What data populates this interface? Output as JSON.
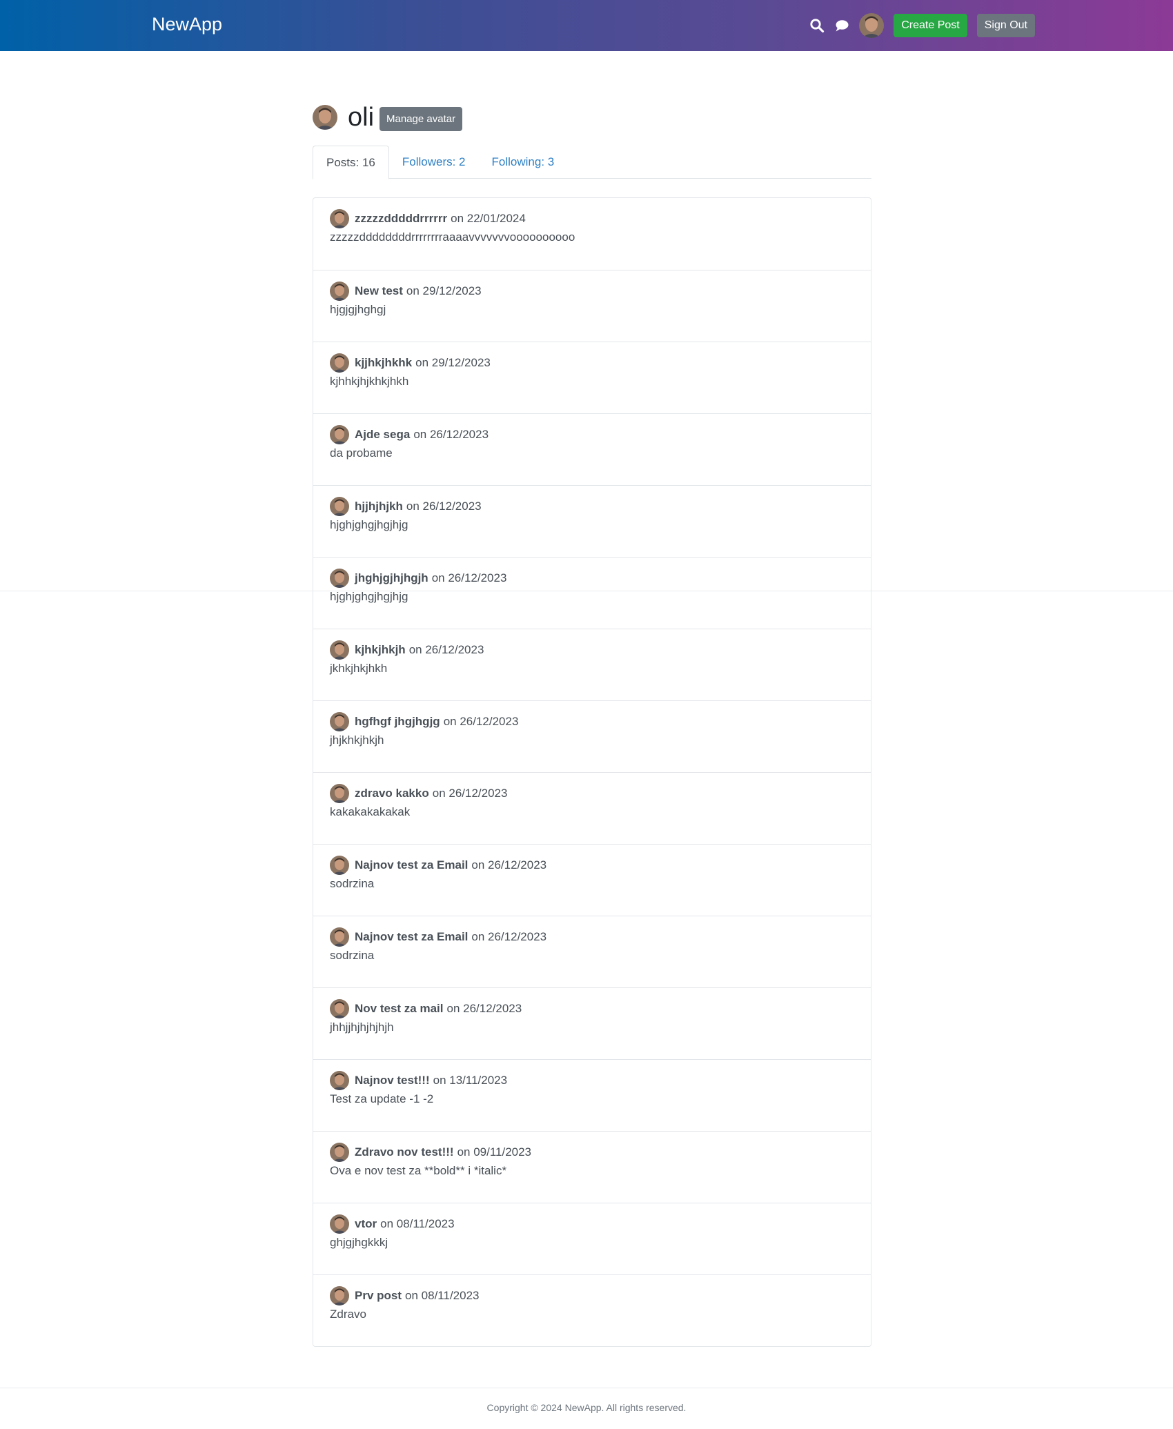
{
  "header": {
    "brand": "NewApp",
    "icons": [
      "search-icon",
      "chat-icon"
    ],
    "create_post_label": "Create Post",
    "sign_out_label": "Sign Out"
  },
  "profile": {
    "username": "oli",
    "manage_avatar_label": "Manage avatar"
  },
  "tabs": [
    {
      "label": "Posts: 16",
      "active": true
    },
    {
      "label": "Followers: 2",
      "active": false
    },
    {
      "label": "Following: 3",
      "active": false
    }
  ],
  "posts": [
    {
      "title": "zzzzzdddddrrrrrr",
      "date": "on 22/01/2024",
      "body": "zzzzzddddddddrrrrrrrraaaavvvvvvvoooooooooo"
    },
    {
      "title": "New test",
      "date": "on 29/12/2023",
      "body": "hjgjgjhghgj"
    },
    {
      "title": "kjjhkjhkhk",
      "date": "on 29/12/2023",
      "body": "kjhhkjhjkhkjhkh"
    },
    {
      "title": "Ajde sega",
      "date": "on 26/12/2023",
      "body": "da probame"
    },
    {
      "title": "hjjhjhjkh",
      "date": "on 26/12/2023",
      "body": "hjghjghgjhgjhjg"
    },
    {
      "title": "jhghjgjhjhgjh",
      "date": "on 26/12/2023",
      "body": "hjghjghgjhgjhjg"
    },
    {
      "title": "kjhkjhkjh",
      "date": "on 26/12/2023",
      "body": "jkhkjhkjhkh"
    },
    {
      "title": "hgfhgf jhgjhgjg",
      "date": "on 26/12/2023",
      "body": "jhjkhkjhkjh"
    },
    {
      "title": "zdravo kakko",
      "date": "on 26/12/2023",
      "body": "kakakakakakak"
    },
    {
      "title": "Najnov test za Email",
      "date": "on 26/12/2023",
      "body": "sodrzina"
    },
    {
      "title": "Najnov test za Email",
      "date": "on 26/12/2023",
      "body": "sodrzina"
    },
    {
      "title": "Nov test za mail",
      "date": "on 26/12/2023",
      "body": "jhhjjhjhjhjhjh"
    },
    {
      "title": "Najnov test!!!",
      "date": "on 13/11/2023",
      "body": "Test za update -1 -2"
    },
    {
      "title": "Zdravo nov test!!!",
      "date": "on 09/11/2023",
      "body": "Ova e nov test za **bold** i *italic*"
    },
    {
      "title": "vtor",
      "date": "on 08/11/2023",
      "body": "ghjgjhgkkkj"
    },
    {
      "title": "Prv post",
      "date": "on 08/11/2023",
      "body": "Zdravo"
    }
  ],
  "footer": {
    "copyright": "Copyright © 2024 NewApp. All rights reserved."
  }
}
